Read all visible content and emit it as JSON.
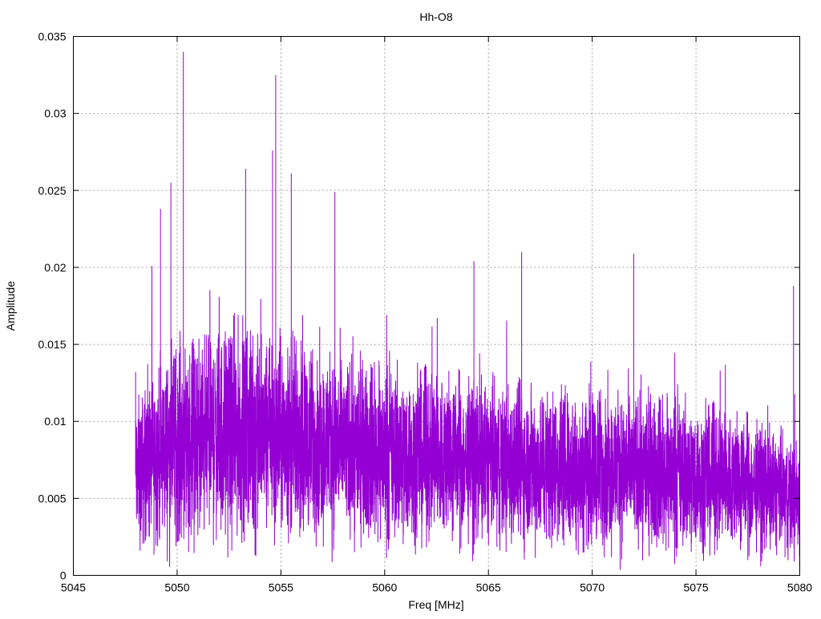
{
  "chart_data": {
    "type": "line",
    "title": "Hh-O8",
    "xlabel": "Freq [MHz]",
    "ylabel": "Amplitude",
    "xlim": [
      5045,
      5080
    ],
    "ylim": [
      0,
      0.035
    ],
    "grid": true,
    "legend": "none",
    "series_color": "#9400d3",
    "x_ticks": [
      "5045",
      "5050",
      "5055",
      "5060",
      "5065",
      "5070",
      "5075",
      "5080"
    ],
    "y_ticks": [
      "0",
      "0.005",
      "0.01",
      "0.015",
      "0.02",
      "0.025",
      "0.03",
      "0.035"
    ],
    "series": [
      {
        "name": "Hh-O8",
        "freq_range": [
          5048.0,
          5080.0
        ],
        "envelope": {
          "freq": [
            5048,
            5050,
            5053,
            5056,
            5060,
            5065,
            5070,
            5075,
            5078,
            5080
          ],
          "mean": [
            0.0065,
            0.0088,
            0.0092,
            0.0088,
            0.0078,
            0.0074,
            0.007,
            0.0064,
            0.0058,
            0.005
          ],
          "spread": [
            0.004,
            0.0055,
            0.0058,
            0.0052,
            0.0047,
            0.0045,
            0.0044,
            0.004,
            0.0036,
            0.0032
          ]
        },
        "peaks": [
          {
            "freq": 5048.0,
            "value": 0.0132
          },
          {
            "freq": 5049.2,
            "value": 0.0238
          },
          {
            "freq": 5049.7,
            "value": 0.0255
          },
          {
            "freq": 5050.3,
            "value": 0.034
          },
          {
            "freq": 5053.3,
            "value": 0.0264
          },
          {
            "freq": 5054.6,
            "value": 0.0276
          },
          {
            "freq": 5054.75,
            "value": 0.0325
          },
          {
            "freq": 5055.5,
            "value": 0.0261
          },
          {
            "freq": 5057.6,
            "value": 0.0249
          },
          {
            "freq": 5064.3,
            "value": 0.0204
          },
          {
            "freq": 5066.6,
            "value": 0.021
          },
          {
            "freq": 5072.0,
            "value": 0.0209
          },
          {
            "freq": 5079.7,
            "value": 0.0188
          }
        ]
      }
    ]
  }
}
